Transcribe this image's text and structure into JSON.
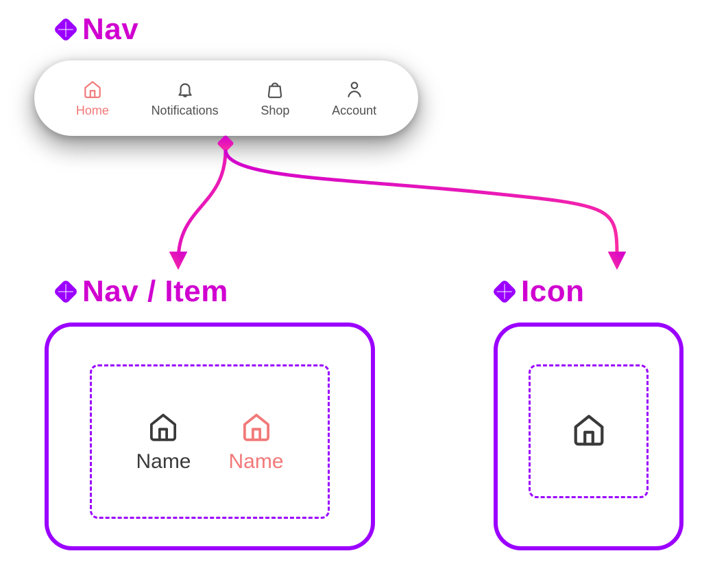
{
  "sections": {
    "nav_label": "Nav",
    "navitem_label": "Nav / Item",
    "icon_label": "Icon"
  },
  "nav": {
    "items": [
      {
        "label": "Home",
        "icon": "home",
        "active": true
      },
      {
        "label": "Notifications",
        "icon": "bell",
        "active": false
      },
      {
        "label": "Shop",
        "icon": "bag",
        "active": false
      },
      {
        "label": "Account",
        "icon": "user",
        "active": false
      }
    ]
  },
  "navitem_variants": {
    "default_label": "Name",
    "active_label": "Name"
  },
  "colors": {
    "purple": "#9b00ff",
    "magenta": "#d000d0",
    "coral": "#f27878",
    "ink": "#3a3a3a"
  }
}
